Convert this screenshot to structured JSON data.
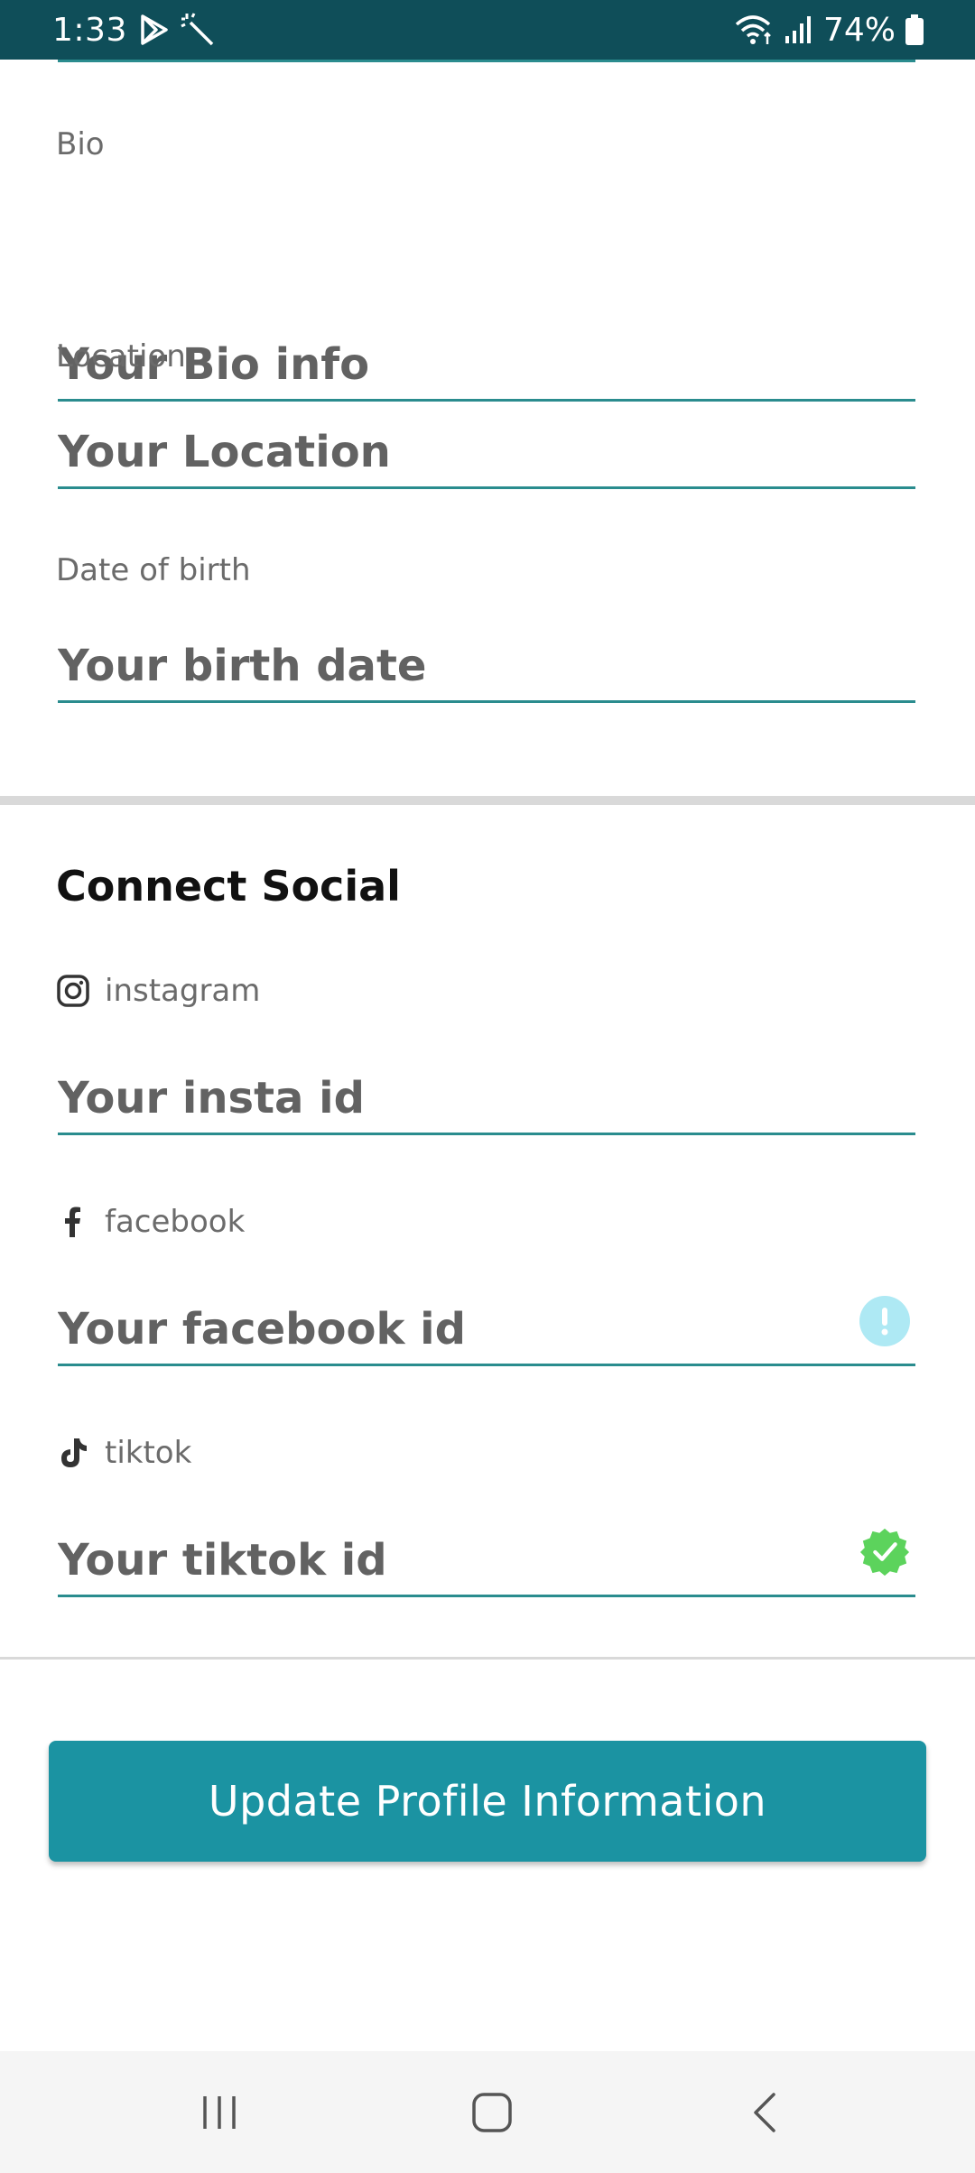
{
  "status_bar": {
    "time": "1:33",
    "battery_percent": "74%",
    "icons": [
      "play-store-icon",
      "magic-wand-icon",
      "wifi-icon",
      "signal-icon",
      "battery-icon"
    ]
  },
  "profile_fields": [
    {
      "label": "Bio",
      "placeholder": "Your Bio info"
    },
    {
      "label": "Location",
      "placeholder": "Your Location"
    },
    {
      "label": "Date of birth",
      "placeholder": "Your birth date"
    }
  ],
  "social": {
    "title": "Connect Social",
    "items": [
      {
        "label": "instagram",
        "icon": "instagram-icon",
        "placeholder": "Your insta id",
        "badge": null
      },
      {
        "label": "facebook",
        "icon": "facebook-icon",
        "placeholder": "Your facebook id",
        "badge": "info-badge-icon"
      },
      {
        "label": "tiktok",
        "icon": "tiktok-icon",
        "placeholder": "Your tiktok id",
        "badge": "verified-badge-icon"
      }
    ]
  },
  "update_button_label": "Update Profile Information",
  "nav_bar": {
    "icons": [
      "recent-apps-icon",
      "home-icon",
      "back-icon"
    ]
  },
  "colors": {
    "status_bar": "#0f4e59",
    "accent": "#2a8c8e",
    "button": "#1b93a2",
    "info_badge": "#aee9f4",
    "verified_badge": "#5cd35c"
  }
}
